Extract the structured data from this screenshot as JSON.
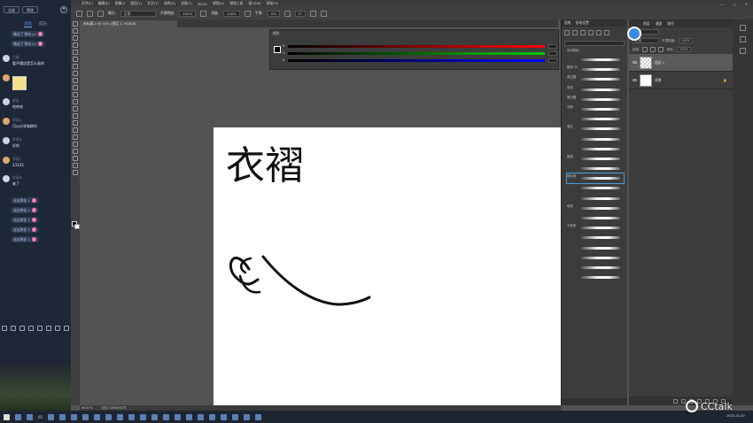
{
  "chat": {
    "top_buttons": [
      "全部",
      "筛选"
    ],
    "tabs": [
      "讨论",
      "成员"
    ],
    "gift_text": "赠送了 鲜花×1",
    "messages": [
      {
        "name": "小张",
        "text": "看不懂这是怎么画的"
      },
      {
        "name": "",
        "text": ""
      },
      {
        "name": "学员",
        "text": "哈哈哈"
      },
      {
        "name": "学员A",
        "text": "可以分享笔刷吗"
      },
      {
        "name": "学员B",
        "text": "好的"
      },
      {
        "name": "学员C",
        "text": "23333"
      },
      {
        "name": "学员D",
        "text": "来了"
      }
    ],
    "gift_repeat": [
      "送出鲜花 1",
      "送出鲜花 1",
      "送出鲜花 1",
      "送出鲜花 1",
      "送出鲜花 1"
    ]
  },
  "ps": {
    "menu": [
      "文件(F)",
      "编辑(E)",
      "图像(I)",
      "图层(L)",
      "文字(Y)",
      "选择(S)",
      "滤镜(T)",
      "3D(D)",
      "视图(V)",
      "增效工具",
      "窗口(W)",
      "帮助(H)"
    ],
    "window_controls": [
      "—",
      "□",
      "✕"
    ],
    "options": {
      "mode_label": "模式:",
      "mode": "正常",
      "opacity_label": "不透明度:",
      "opacity": "100%",
      "flow_label": "流量:",
      "flow": "100%",
      "smooth_label": "平滑:",
      "smooth": "0%",
      "angle": "0°"
    },
    "doc_tab": "未标题-1 @ 50% (图层 1, RGB/8)",
    "color_panel": {
      "title": "颜色",
      "labels": [
        "R",
        "G",
        "B"
      ]
    },
    "canvas_text": "衣褶",
    "status": [
      "66.67%",
      "文档:2.86M/0字节"
    ],
    "brush_panel": {
      "tabs": [
        "画笔",
        "画笔设置"
      ],
      "group": "常用笔刷",
      "items": [
        "",
        "圆角 50",
        "柔边圆",
        "炭笔",
        "硬边圆",
        "流畅",
        "",
        "湿边",
        "",
        "",
        "粗糙",
        "",
        "硬毛刷",
        "",
        "",
        "喷溅",
        "",
        "干画笔",
        "",
        "",
        "",
        "",
        ""
      ]
    },
    "layers_panel": {
      "tabs": [
        "图层",
        "通道",
        "路径"
      ],
      "kind_label": "类型",
      "blend": "正常",
      "opacity_label": "不透明度:",
      "opacity": "100%",
      "lock_label": "锁定:",
      "fill_label": "填充:",
      "fill": "100%",
      "layers": [
        {
          "name": "图层 1",
          "selected": true
        },
        {
          "name": "背景",
          "selected": false
        }
      ]
    }
  },
  "cctalk": "CCtalk",
  "clock": "2022-01-02",
  "taskbar_label": "05"
}
